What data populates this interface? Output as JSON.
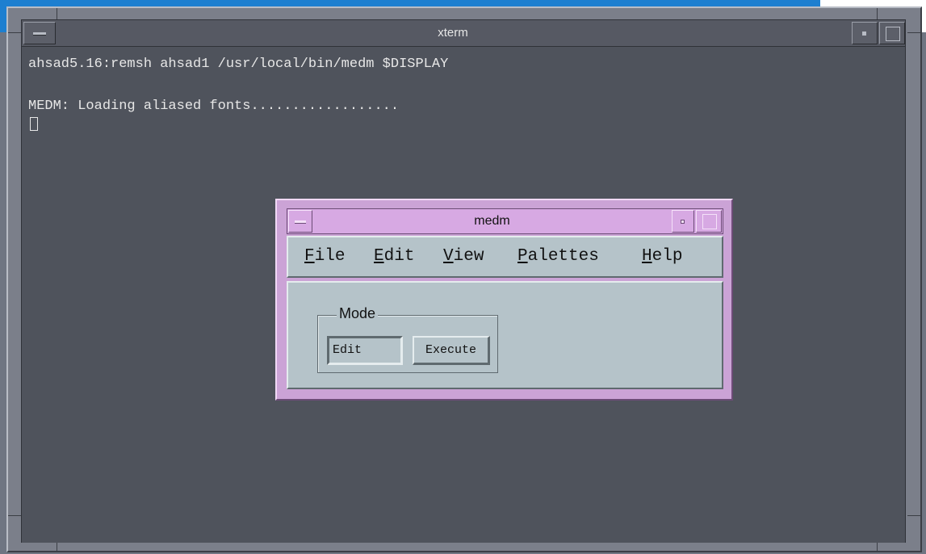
{
  "xterm": {
    "title": "xterm",
    "lines": [
      "ahsad5.16:remsh ahsad1 /usr/local/bin/medm $DISPLAY",
      "MEDM: Loading aliased fonts.................."
    ]
  },
  "medm": {
    "title": "medm",
    "menu": [
      {
        "mnemonic": "F",
        "rest": "ile"
      },
      {
        "mnemonic": "E",
        "rest": "dit"
      },
      {
        "mnemonic": "V",
        "rest": "iew"
      },
      {
        "mnemonic": "P",
        "rest": "alettes"
      },
      {
        "mnemonic": "H",
        "rest": "elp"
      }
    ],
    "mode": {
      "label": "Mode",
      "edit_label": "Edit",
      "execute_label": "Execute",
      "selected": "Edit"
    }
  },
  "colors": {
    "terminal_bg": "#4f535c",
    "medm_frame": "#cba3d6",
    "medm_panel": "#b5c3c9",
    "desktop": "#1d7fd0"
  }
}
